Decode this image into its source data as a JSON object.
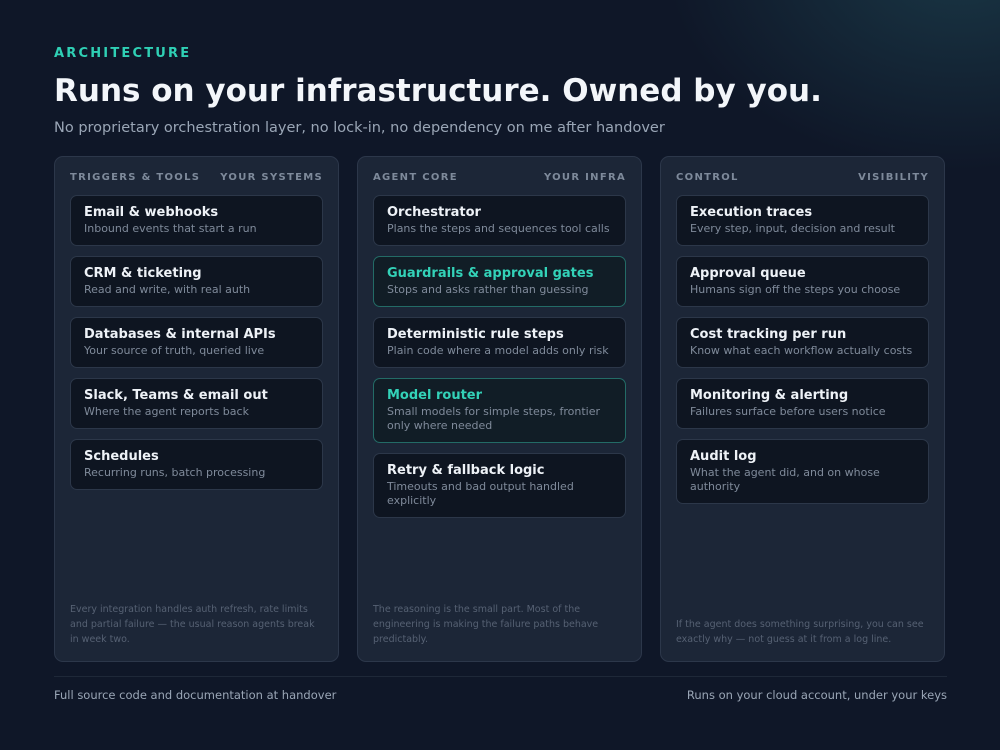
{
  "header": {
    "eyebrow": "ARCHITECTURE",
    "title": "Runs on your infrastructure. Owned by you.",
    "subtitle": "No proprietary orchestration layer, no lock-in, no dependency on me after handover"
  },
  "columns": [
    {
      "heading_left": "TRIGGERS & TOOLS",
      "heading_right": "YOUR SYSTEMS",
      "cards": [
        {
          "title": "Email & webhooks",
          "desc": "Inbound events that start a run"
        },
        {
          "title": "CRM & ticketing",
          "desc": "Read and write, with real auth"
        },
        {
          "title": "Databases & internal APIs",
          "desc": "Your source of truth, queried live"
        },
        {
          "title": "Slack, Teams & email out",
          "desc": "Where the agent reports back"
        },
        {
          "title": "Schedules",
          "desc": "Recurring runs, batch processing"
        }
      ],
      "footnote": "Every integration handles auth refresh, rate limits and partial failure — the usual reason agents break in week two."
    },
    {
      "heading_left": "AGENT CORE",
      "heading_right": "YOUR INFRA",
      "cards": [
        {
          "title": "Orchestrator",
          "desc": "Plans the steps and sequences tool calls"
        },
        {
          "title": "Guardrails & approval gates",
          "desc": "Stops and asks rather than guessing",
          "highlight": true
        },
        {
          "title": "Deterministic rule steps",
          "desc": "Plain code where a model adds only risk"
        },
        {
          "title": "Model router",
          "desc": "Small models for simple steps, frontier only where needed",
          "highlight": true
        },
        {
          "title": "Retry & fallback logic",
          "desc": "Timeouts and bad output handled explicitly"
        }
      ],
      "footnote": "The reasoning is the small part. Most of the engineering is making the failure paths behave predictably."
    },
    {
      "heading_left": "CONTROL",
      "heading_right": "VISIBILITY",
      "cards": [
        {
          "title": "Execution traces",
          "desc": "Every step, input, decision and result"
        },
        {
          "title": "Approval queue",
          "desc": "Humans sign off the steps you choose"
        },
        {
          "title": "Cost tracking per run",
          "desc": "Know what each workflow actually costs"
        },
        {
          "title": "Monitoring & alerting",
          "desc": "Failures surface before users notice"
        },
        {
          "title": "Audit log",
          "desc": "What the agent did, and on whose authority"
        }
      ],
      "footnote": "If the agent does something surprising, you can see exactly why — not guess at it from a log line."
    }
  ],
  "footer": {
    "left": "Full source code and documentation at handover",
    "right": "Runs on your cloud account, under your keys"
  },
  "colors": {
    "accent": "#2fd0b5",
    "background": "#0f1728",
    "panel": "#1c2637",
    "card": "#0e1521"
  }
}
